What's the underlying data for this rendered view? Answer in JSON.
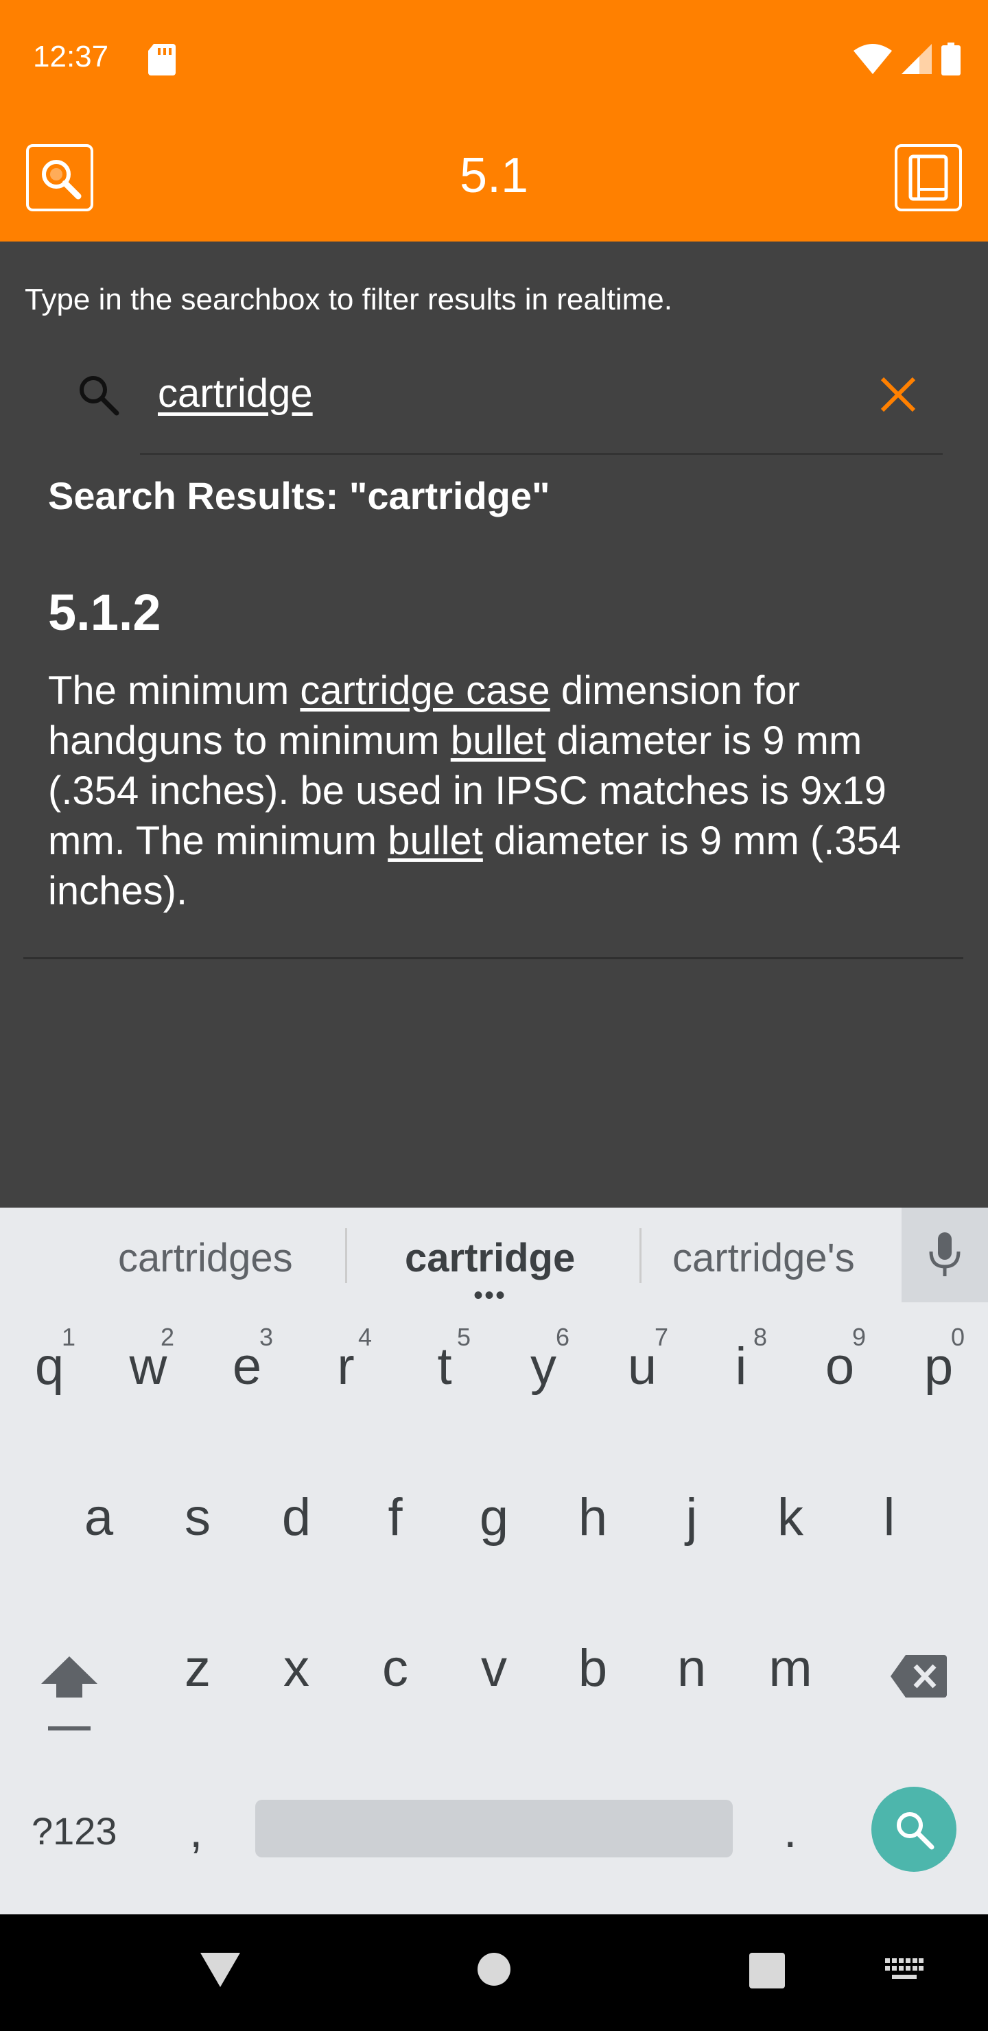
{
  "status": {
    "time": "12:37",
    "icons": [
      "sd-card-icon",
      "wifi-icon",
      "signal-icon",
      "battery-icon"
    ]
  },
  "appbar": {
    "title": "5.1",
    "left_icon": "search-icon",
    "right_icon": "book-icon",
    "color": "#FF8000"
  },
  "content": {
    "hint": "Type in the searchbox to filter results in realtime.",
    "search": {
      "value": "cartridge"
    },
    "results_title": "Search Results: \"cartridge\"",
    "result": {
      "id": "5.1.2",
      "text_parts": [
        "The minimum ",
        "cartridge case",
        " dimension for handguns to minimum ",
        "bullet",
        " diameter is 9 mm (.354 inches).  be used in IPSC matches is 9x19  mm. The minimum ",
        "bullet",
        " diameter is 9 mm (.354 inches)."
      ]
    }
  },
  "keyboard": {
    "suggestions": [
      "cartridges",
      "cartridge",
      "cartridge's"
    ],
    "row1": [
      {
        "ch": "q",
        "num": "1"
      },
      {
        "ch": "w",
        "num": "2"
      },
      {
        "ch": "e",
        "num": "3"
      },
      {
        "ch": "r",
        "num": "4"
      },
      {
        "ch": "t",
        "num": "5"
      },
      {
        "ch": "y",
        "num": "6"
      },
      {
        "ch": "u",
        "num": "7"
      },
      {
        "ch": "i",
        "num": "8"
      },
      {
        "ch": "o",
        "num": "9"
      },
      {
        "ch": "p",
        "num": "0"
      }
    ],
    "row2": [
      "a",
      "s",
      "d",
      "f",
      "g",
      "h",
      "j",
      "k",
      "l"
    ],
    "row3": [
      "z",
      "x",
      "c",
      "v",
      "b",
      "n",
      "m"
    ],
    "symbols_label": "?123",
    "comma": ",",
    "period": ".",
    "go_color": "#4DB6AC"
  }
}
